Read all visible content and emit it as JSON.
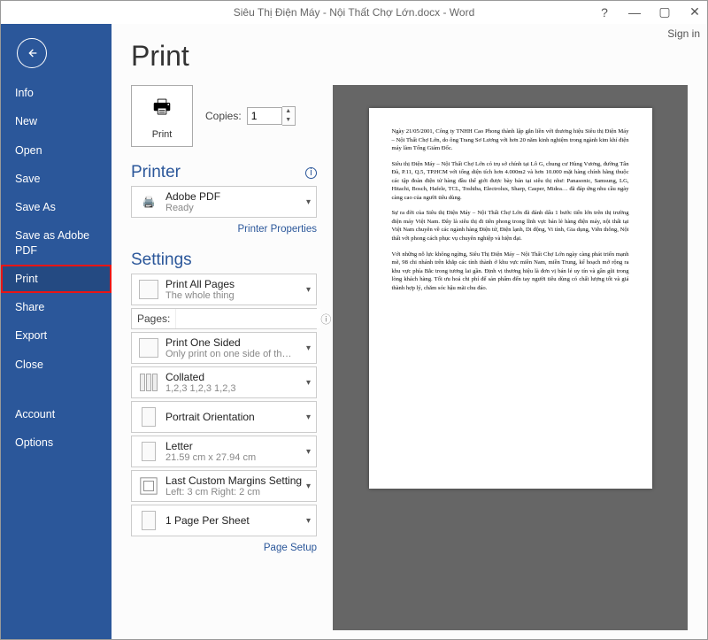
{
  "window": {
    "title": "Siêu Thị Điện Máy - Nội Thất Chợ Lớn.docx - Word",
    "help": "?",
    "minimize": "—",
    "maximize": "▢",
    "close": "✕",
    "signin": "Sign in"
  },
  "sidebar": {
    "items": [
      {
        "label": "Info"
      },
      {
        "label": "New"
      },
      {
        "label": "Open"
      },
      {
        "label": "Save"
      },
      {
        "label": "Save As"
      },
      {
        "label": "Save as Adobe PDF"
      },
      {
        "label": "Print"
      },
      {
        "label": "Share"
      },
      {
        "label": "Export"
      },
      {
        "label": "Close"
      }
    ],
    "bottom": [
      {
        "label": "Account"
      },
      {
        "label": "Options"
      }
    ]
  },
  "page": {
    "heading": "Print",
    "print_button_label": "Print",
    "copies_label": "Copies:",
    "copies_value": "1",
    "section_printer": "Printer",
    "printer": {
      "name": "Adobe PDF",
      "status": "Ready"
    },
    "printer_properties": "Printer Properties",
    "section_settings": "Settings",
    "settings": [
      {
        "title": "Print All Pages",
        "sub": "The whole thing"
      },
      {
        "title": "Print One Sided",
        "sub": "Only print on one side of th…"
      },
      {
        "title": "Collated",
        "sub": "1,2,3   1,2,3   1,2,3"
      },
      {
        "title": "Portrait Orientation",
        "sub": ""
      },
      {
        "title": "Letter",
        "sub": "21.59 cm x 27.94 cm"
      },
      {
        "title": "Last Custom Margins Setting",
        "sub": "Left: 3 cm   Right: 2 cm"
      },
      {
        "title": "1 Page Per Sheet",
        "sub": ""
      }
    ],
    "pages_label": "Pages:",
    "pages_value": "",
    "page_setup": "Page Setup"
  },
  "preview": {
    "p1": "Ngày 21/05/2001, Công ty TNHH Cao Phong thành lập gắn liền với thương hiệu Siêu thị Điện Máy – Nội Thất Chợ Lớn, do ông Trang Sơ Lương với hơn 20 năm kinh nghiệm trong ngành kim khí điện máy làm Tổng Giám Đốc.",
    "p2": "Siêu thị Điện Máy – Nội Thất Chợ Lớn có trụ sở chính tại Lô G, chung cư Hùng Vương, đường Tân Đà, P.11, Q.5, TP.HCM với tổng diện tích hơn 4.000m2 và hơn 10.000 mặt hàng chính hãng thuộc các tập đoàn điện tử hàng đầu thế giới được bày bán tại siêu thị như: Panasonic, Samsung, LG, Hitachi, Bosch, Hafele, TCL, Toshiba, Electrolux, Sharp, Casper, Midea… đã đáp ứng nhu cầu ngày càng cao của người tiêu dùng.",
    "p3": "Sự ra đời của Siêu thị Điện Máy – Nội Thất Chợ Lớn đã đánh dấu 1 bước tiến lớn trên thị trường điện máy Việt Nam. Đây là siêu thị đi tiên phong trong lĩnh vực bán lẻ hàng điện máy, nội thất tại Việt Nam chuyên về các ngành hàng Điện tử, Điện lạnh, Di động, Vi tính, Gia dụng, Viễn thông, Nội thất với phong cách phục vụ chuyên nghiệp và hiện đại.",
    "p4": "Với những nỗ lực không ngừng, Siêu Thị Điện Máy – Nội Thất Chợ Lớn ngày càng phát triển mạnh mẽ, 98 chi nhánh trên khắp các tỉnh thành ở khu vực miền Nam, miền Trung, kế hoạch mở rộng ra khu vực phía Bắc trong tương lai gần. Định vị thương hiệu là đơn vị bán lẻ uy tín và gần gũi trong lòng khách hàng. Tối ưu hoá chi phí để sản phẩm đến tay người tiêu dùng có chất lượng tốt và giá thành hợp lý, chăm sóc hậu mãi chu đáo."
  }
}
